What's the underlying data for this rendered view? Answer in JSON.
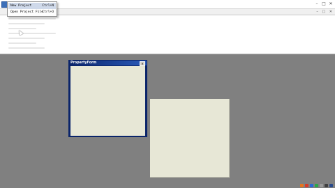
{
  "window": {
    "minimize_glyph": "–",
    "maximize_glyph": "□",
    "close_glyph": "✕"
  },
  "menubar": {
    "mdi_buttons": "– □ ✕"
  },
  "file_menu": {
    "items": [
      {
        "label": "New Project",
        "shortcut": "Ctrl+N",
        "selected": true
      },
      {
        "label": "Open Project File",
        "shortcut": "Ctrl+O",
        "selected": false
      }
    ]
  },
  "form_window": {
    "title": "PropertyForm",
    "close_glyph": "✕"
  },
  "tray_icons": [
    {
      "name": "orange-tray-icon",
      "color": "#e8741e"
    },
    {
      "name": "red-tray-icon",
      "color": "#d83a2a"
    },
    {
      "name": "blue-tray-icon",
      "color": "#2a6ad8"
    },
    {
      "name": "green-tray-icon",
      "color": "#2aa84a"
    },
    {
      "name": "gray-tray-icon",
      "color": "#9a9a9a"
    },
    {
      "name": "dark-tray-icon",
      "color": "#404040"
    },
    {
      "name": "navy-tray-icon",
      "color": "#2a4a8a"
    }
  ],
  "colors": {
    "workspace": "#808080",
    "form_title": "#0a246a",
    "form_client": "#e7e7d6",
    "menu_highlight": "#cfd9ea"
  }
}
